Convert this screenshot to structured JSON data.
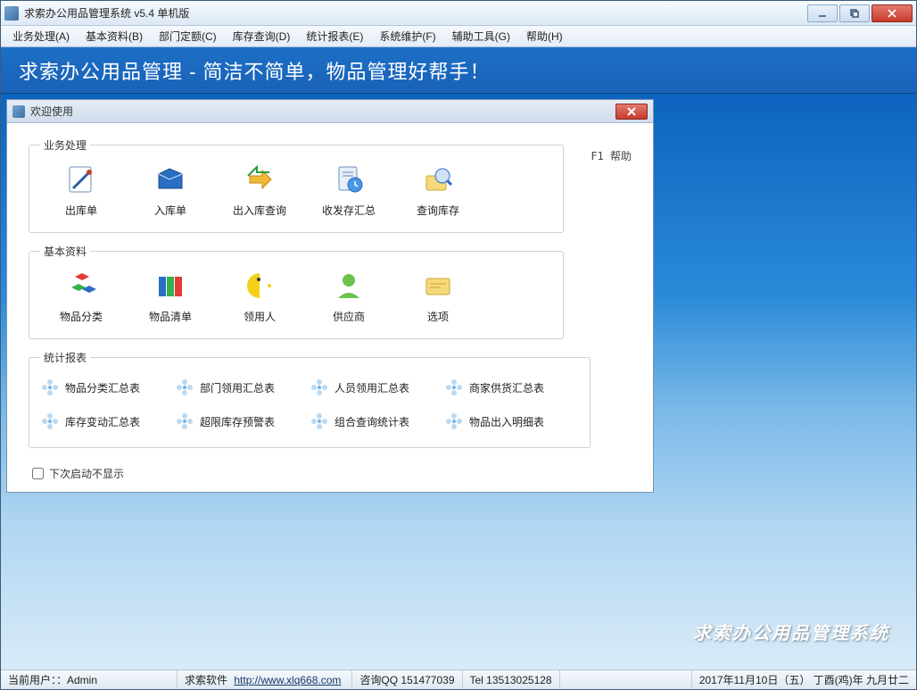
{
  "window": {
    "title": "求索办公用品管理系统 v5.4 单机版"
  },
  "menu": [
    "业务处理(A)",
    "基本资料(B)",
    "部门定额(C)",
    "库存查询(D)",
    "统计报表(E)",
    "系统维护(F)",
    "辅助工具(G)",
    "帮助(H)"
  ],
  "banner": "求索办公用品管理 - 简洁不简单，物品管理好帮手！",
  "dialog": {
    "title": "欢迎使用",
    "help": "F1 帮助",
    "groups": {
      "business": {
        "label": "业务处理",
        "items": [
          "出库单",
          "入库单",
          "出入库查询",
          "收发存汇总",
          "查询库存"
        ]
      },
      "basic": {
        "label": "基本资料",
        "items": [
          "物品分类",
          "物品清单",
          "领用人",
          "供应商",
          "选项"
        ]
      },
      "reports": {
        "label": "统计报表",
        "items": [
          "物品分类汇总表",
          "部门领用汇总表",
          "人员领用汇总表",
          "商家供货汇总表",
          "库存变动汇总表",
          "超限库存预警表",
          "组合查询统计表",
          "物品出入明细表"
        ]
      }
    },
    "dont_show": "下次启动不显示"
  },
  "brand": "求索办公用品管理系统",
  "status": {
    "user_label": "当前用户：：Admin",
    "company": "求索软件",
    "url": "http://www.xlq668.com",
    "qq": "咨询QQ 151477039",
    "tel": "Tel 13513025128",
    "date": "2017年11月10日（五）  丁酉(鸡)年 九月廿二"
  },
  "icons": {
    "business": [
      "notepad-icon",
      "folder-blue-icon",
      "swap-arrows-icon",
      "clipboard-clock-icon",
      "magnifier-folder-icon"
    ],
    "basic": [
      "cubes-icon",
      "folders-color-icon",
      "pacman-icon",
      "user-green-icon",
      "card-icon"
    ]
  }
}
